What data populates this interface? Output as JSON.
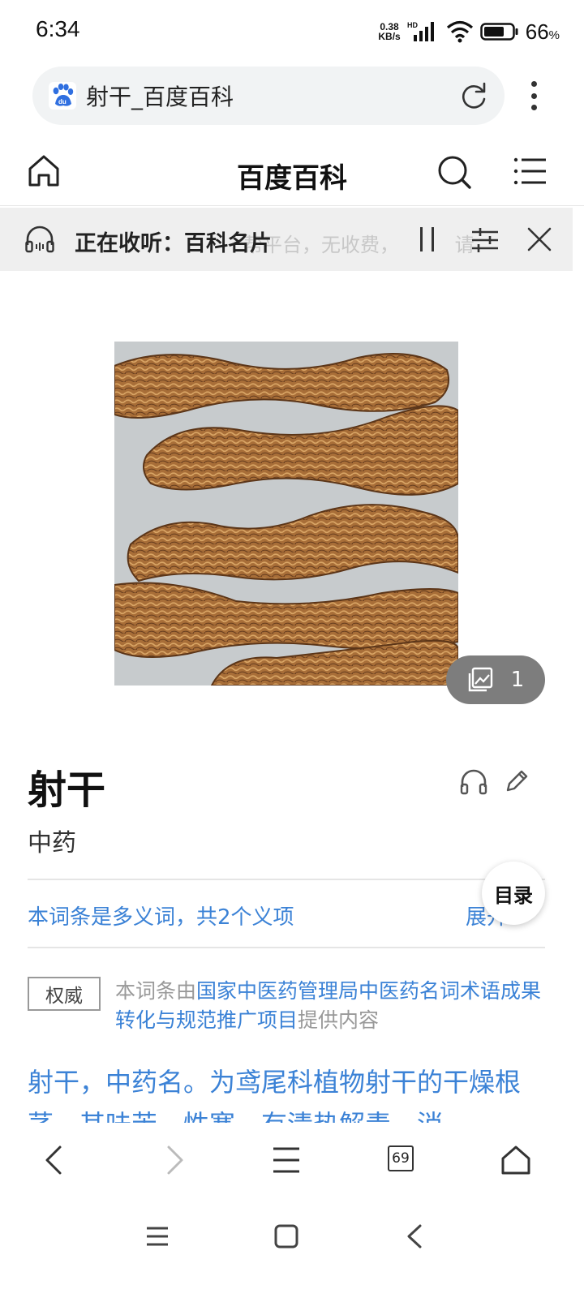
{
  "status_bar": {
    "time": "6:34",
    "net_speed_value": "0.38",
    "net_speed_unit": "KB/s",
    "network_type": "HD",
    "battery_level": "66",
    "battery_unit": "%"
  },
  "address_bar": {
    "page_title": "射干_百度百科"
  },
  "site_header": {
    "title": "百度百科"
  },
  "listen_bar": {
    "label": "正在收听：百科名片",
    "ghost_text": "帮平台，无收费，",
    "ghost_tail": "请"
  },
  "gallery": {
    "image_count": "1"
  },
  "entry": {
    "title": "射干",
    "subtitle": "中药",
    "polysemy_text": "本词条是多义词，共2个义项",
    "expand_label": "展开",
    "toc_label": "目录",
    "authority_badge": "权威",
    "authority_prefix": "本词条由",
    "authority_source": "国家中医药管理局中医药名词术语成果转化与规范推广项目",
    "authority_suffix": "提供内容",
    "summary": "射干，中药名。为鸢尾科植物射干的干燥根茎。其味苦，性寒。有清热解毒，消"
  },
  "browser_toolbar": {
    "tab_count": "69"
  },
  "colors": {
    "link_blue": "#3b82d6",
    "listen_bar_bg": "#efefef",
    "address_bar_bg": "#f1f3f4"
  }
}
